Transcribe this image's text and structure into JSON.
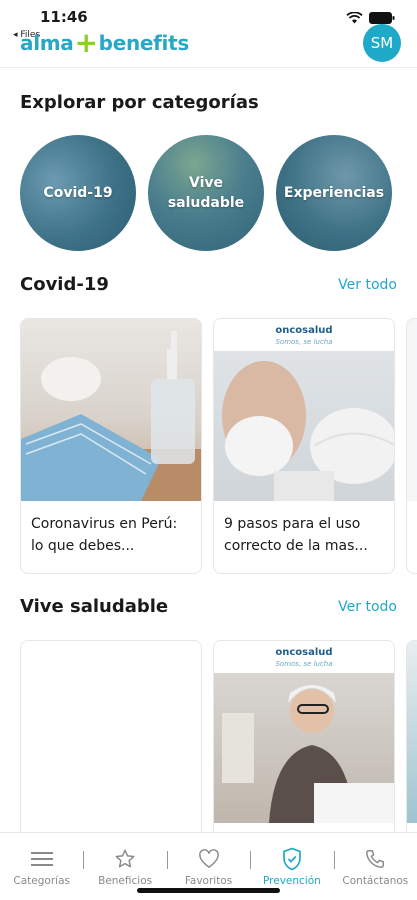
{
  "status_bar": {
    "time": "11:46",
    "back_label": "◂ Files"
  },
  "header": {
    "logo_left": "alma",
    "logo_right": "benefits",
    "avatar_initials": "SM",
    "brand_color": "#1ea9c9",
    "accent_color": "#8bcf2d"
  },
  "explore": {
    "title": "Explorar por categorías",
    "categories": [
      {
        "label": "Covid-19"
      },
      {
        "label": "Vive saludable"
      },
      {
        "label": "Experiencias"
      }
    ]
  },
  "covid_section": {
    "title": "Covid-19",
    "see_all": "Ver todo",
    "cards": [
      {
        "text": "Coronavirus en Perú: lo que debes..."
      },
      {
        "text": "9 pasos para el uso correcto de la mas...",
        "brand": "oncosalud",
        "tagline": "Somos, se lucha"
      }
    ]
  },
  "healthy_section": {
    "title": "Vive saludable",
    "see_all": "Ver todo",
    "cards": [
      {
        "text": ""
      },
      {
        "text": "",
        "brand": "oncosalud",
        "tagline": "Somos, se lucha"
      }
    ]
  },
  "bottom_nav": {
    "items": [
      {
        "label": "Categorías",
        "icon": "menu-icon"
      },
      {
        "label": "Beneficios",
        "icon": "star-icon"
      },
      {
        "label": "Favoritos",
        "icon": "heart-icon"
      },
      {
        "label": "Prevención",
        "icon": "shield-icon",
        "active": true
      },
      {
        "label": "Contáctanos",
        "icon": "phone-icon"
      }
    ]
  }
}
